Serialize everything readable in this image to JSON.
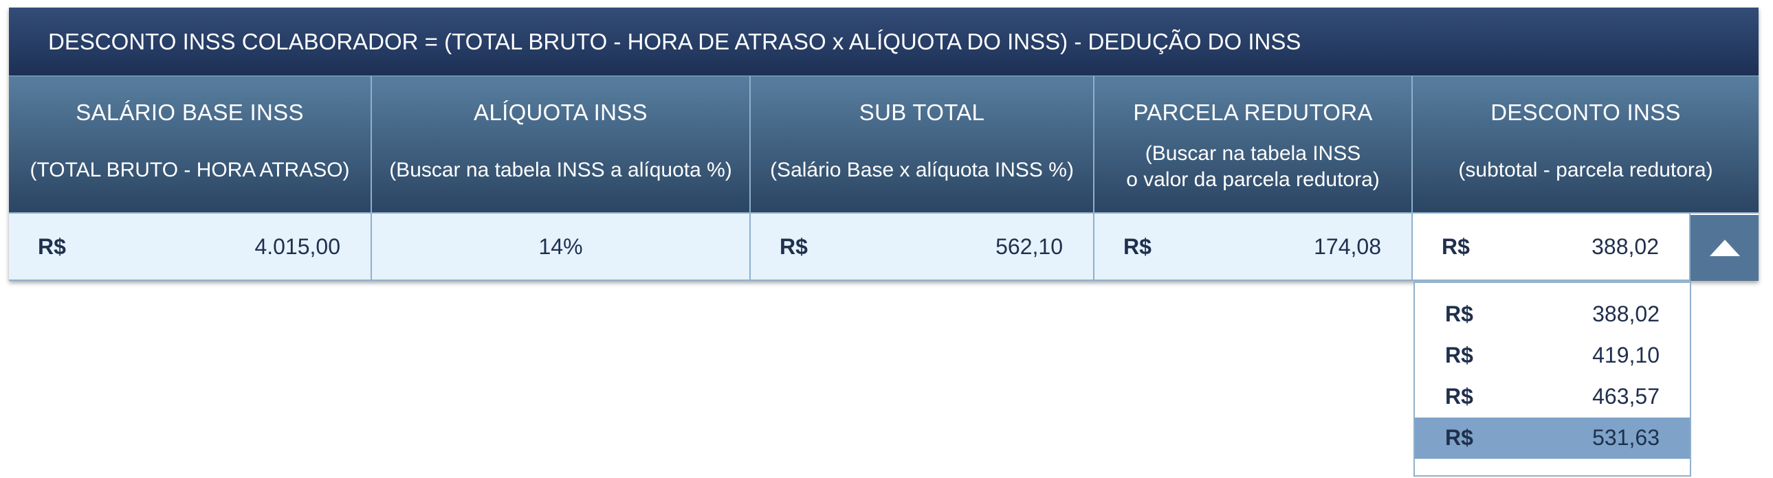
{
  "title": "DESCONTO INSS COLABORADOR = (TOTAL BRUTO - HORA DE ATRASO x ALÍQUOTA DO INSS) - DEDUÇÃO DO INSS",
  "columns": [
    {
      "title": "SALÁRIO BASE INSS",
      "subtitle": "(TOTAL BRUTO - HORA ATRASO)"
    },
    {
      "title": "ALÍQUOTA INSS",
      "subtitle": "(Buscar na tabela INSS a alíquota %)"
    },
    {
      "title": "SUB TOTAL",
      "subtitle": "(Salário Base x alíquota INSS %)"
    },
    {
      "title": "PARCELA REDUTORA",
      "subtitle_line1": "(Buscar na tabela INSS",
      "subtitle_line2": "o valor da parcela redutora)"
    },
    {
      "title": "DESCONTO INSS",
      "subtitle": "(subtotal - parcela redutora)"
    }
  ],
  "row": {
    "salario_base": {
      "currency": "R$",
      "value": "4.015,00"
    },
    "aliquota": "14%",
    "sub_total": {
      "currency": "R$",
      "value": "562,10"
    },
    "parcela_redutora": {
      "currency": "R$",
      "value": "174,08"
    },
    "desconto": {
      "currency": "R$",
      "value": "388,02"
    }
  },
  "dropdown": {
    "icon": "triangle-up-icon",
    "options": [
      {
        "currency": "R$",
        "value": "388,02"
      },
      {
        "currency": "R$",
        "value": "419,10"
      },
      {
        "currency": "R$",
        "value": "463,57"
      },
      {
        "currency": "R$",
        "value": "531,63"
      }
    ],
    "highlighted_index": 3
  },
  "colors": {
    "title_bg": "#1d3055",
    "header_bg": "#587e9f",
    "row_bg": "#e6f2fc",
    "highlight": "#7ea2c8",
    "button_bg": "#527597"
  }
}
